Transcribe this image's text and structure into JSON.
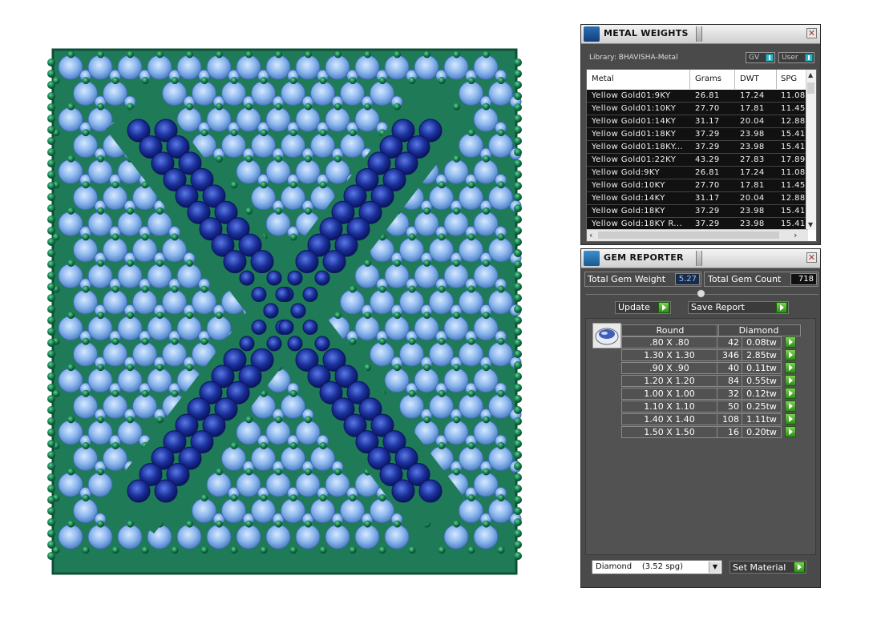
{
  "colors": {
    "metal_green": "#1f7a57",
    "metal_green_dark": "#0f5138",
    "diamond_light": "#8db8ee",
    "sapphire_blue": "#1a2f99",
    "panel_bg": "#4a4a4a",
    "go_green": "#4cae2e"
  },
  "metal_weights": {
    "title": "METAL WEIGHTS",
    "library_label": "Library: BHAVISHA-Metal",
    "toggle_gv": "GV",
    "toggle_user": "User",
    "columns": [
      "Metal",
      "Grams",
      "DWT",
      "SPG"
    ],
    "rows": [
      [
        "Yellow Gold01:9KY",
        "26.81",
        "17.24",
        "11.08"
      ],
      [
        "Yellow Gold01:10KY",
        "27.70",
        "17.81",
        "11.45"
      ],
      [
        "Yellow Gold01:14KY",
        "31.17",
        "20.04",
        "12.88"
      ],
      [
        "Yellow Gold01:18KY",
        "37.29",
        "23.98",
        "15.41"
      ],
      [
        "Yellow Gold01:18KY...",
        "37.29",
        "23.98",
        "15.41"
      ],
      [
        "Yellow Gold01:22KY",
        "43.29",
        "27.83",
        "17.89"
      ],
      [
        "Yellow Gold:9KY",
        "26.81",
        "17.24",
        "11.08"
      ],
      [
        "Yellow Gold:10KY",
        "27.70",
        "17.81",
        "11.45"
      ],
      [
        "Yellow Gold:14KY",
        "31.17",
        "20.04",
        "12.88"
      ],
      [
        "Yellow Gold:18KY",
        "37.29",
        "23.98",
        "15.41"
      ],
      [
        "Yellow Gold:18KY R...",
        "37.29",
        "23.98",
        "15.41"
      ]
    ]
  },
  "gem_reporter": {
    "title": "GEM REPORTER",
    "total_weight_label": "Total Gem Weight",
    "total_weight_value": "5.27",
    "total_count_label": "Total Gem Count",
    "total_count_value": "718",
    "update_label": "Update",
    "save_label": "Save Report",
    "col_shape": "Round",
    "col_type": "Diamond",
    "gems": [
      {
        "size": ".80 X .80",
        "count": "42",
        "weight": "0.08tw"
      },
      {
        "size": "1.30 X 1.30",
        "count": "346",
        "weight": "2.85tw"
      },
      {
        "size": ".90 X .90",
        "count": "40",
        "weight": "0.11tw"
      },
      {
        "size": "1.20 X 1.20",
        "count": "84",
        "weight": "0.55tw"
      },
      {
        "size": "1.00 X 1.00",
        "count": "32",
        "weight": "0.12tw"
      },
      {
        "size": "1.10 X 1.10",
        "count": "50",
        "weight": "0.25tw"
      },
      {
        "size": "1.40 X 1.40",
        "count": "108",
        "weight": "1.11tw"
      },
      {
        "size": "1.50 X 1.50",
        "count": "16",
        "weight": "0.20tw"
      }
    ],
    "material_value": "Diamond    (3.52 spg)",
    "set_material_label": "Set Material"
  }
}
